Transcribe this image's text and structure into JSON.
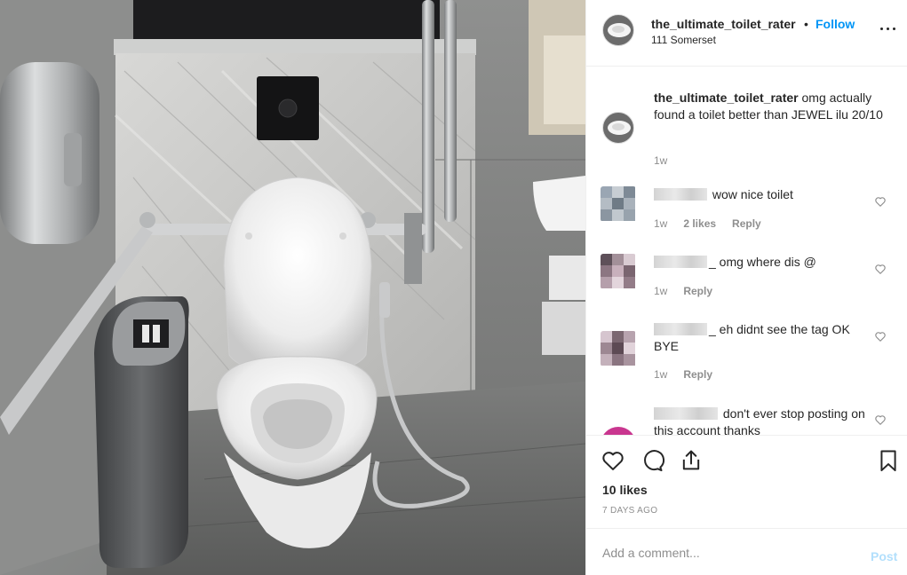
{
  "header": {
    "username": "the_ultimate_toilet_rater",
    "separator": "•",
    "follow_label": "Follow",
    "location": "111 Somerset"
  },
  "caption": {
    "username": "the_ultimate_toilet_rater",
    "text": " omg actually found a toilet better than JEWEL ilu 20/10",
    "time": "1w"
  },
  "comments": [
    {
      "text": "wow nice toilet",
      "time": "1w",
      "likes": "2 likes",
      "reply": "Reply"
    },
    {
      "text": "_ omg where dis @",
      "time": "1w",
      "reply": "Reply"
    },
    {
      "text": "_ eh didnt see the tag OK BYE",
      "time": "1w",
      "reply": "Reply"
    },
    {
      "text": "don't ever stop posting on this account thanks"
    }
  ],
  "actions": {
    "likes": "10 likes",
    "date": "7 DAYS AGO"
  },
  "add_comment": {
    "placeholder": "Add a comment...",
    "post_label": "Post"
  },
  "icons": [
    "more-icon",
    "heart-icon",
    "comment-icon",
    "share-icon",
    "bookmark-icon"
  ],
  "colors": {
    "accent": "#0095f6",
    "post_disabled": "#b2dffc",
    "muted": "#8e8e8e",
    "text": "#262626"
  }
}
